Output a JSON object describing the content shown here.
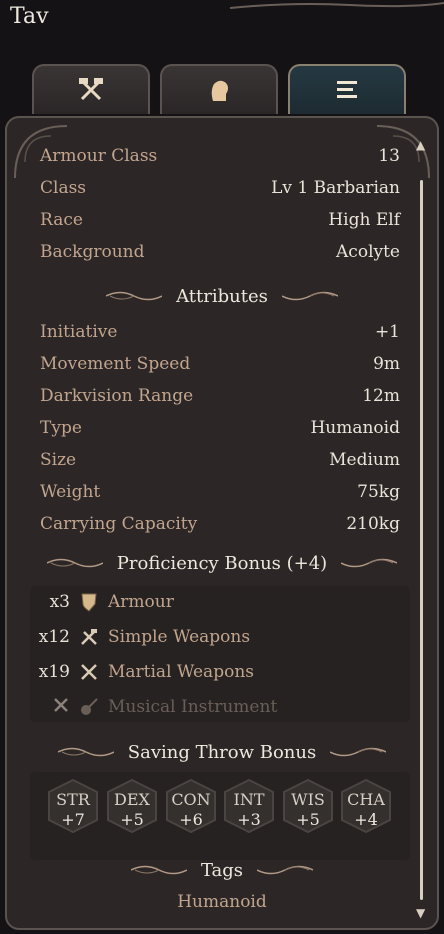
{
  "window": {
    "title": "Tav"
  },
  "tabs": [
    {
      "name": "equipment-tab",
      "icon": "crossed-hammers-icon"
    },
    {
      "name": "character-tab",
      "icon": "head-profile-icon"
    },
    {
      "name": "details-tab",
      "icon": "list-icon",
      "active": true
    }
  ],
  "summary": [
    {
      "label": "Armour Class",
      "value": "13"
    },
    {
      "label": "Class",
      "value": "Lv 1 Barbarian"
    },
    {
      "label": "Race",
      "value": "High Elf"
    },
    {
      "label": "Background",
      "value": "Acolyte"
    }
  ],
  "attributes_header": "Attributes",
  "attributes": [
    {
      "label": "Initiative",
      "value": "+1"
    },
    {
      "label": "Movement Speed",
      "value": "9m"
    },
    {
      "label": "Darkvision Range",
      "value": "12m"
    },
    {
      "label": "Type",
      "value": "Humanoid"
    },
    {
      "label": "Size",
      "value": "Medium"
    },
    {
      "label": "Weight",
      "value": "75kg"
    },
    {
      "label": "Carrying Capacity",
      "value": "210kg"
    }
  ],
  "proficiency_header": "Proficiency Bonus (+4)",
  "proficiencies": [
    {
      "count": "x3",
      "icon": "armour-icon",
      "label": "Armour"
    },
    {
      "count": "x12",
      "icon": "simple-weapons-icon",
      "label": "Simple Weapons"
    },
    {
      "count": "x19",
      "icon": "martial-weapons-icon",
      "label": "Martial Weapons"
    },
    {
      "count": "",
      "icon": "lute-icon",
      "label": "Musical Instrument",
      "disabled": true
    }
  ],
  "saving_header": "Saving Throw Bonus",
  "saving_throws": [
    {
      "ability": "STR",
      "bonus": "+7"
    },
    {
      "ability": "DEX",
      "bonus": "+5"
    },
    {
      "ability": "CON",
      "bonus": "+6"
    },
    {
      "ability": "INT",
      "bonus": "+3"
    },
    {
      "ability": "WIS",
      "bonus": "+5"
    },
    {
      "ability": "CHA",
      "bonus": "+4"
    }
  ],
  "tags_header": "Tags",
  "tags": [
    "Humanoid"
  ],
  "colors": {
    "label": "#c2a58e",
    "value": "#eae3d8",
    "panel": "#2c2726",
    "accent_tab": "#253942"
  }
}
